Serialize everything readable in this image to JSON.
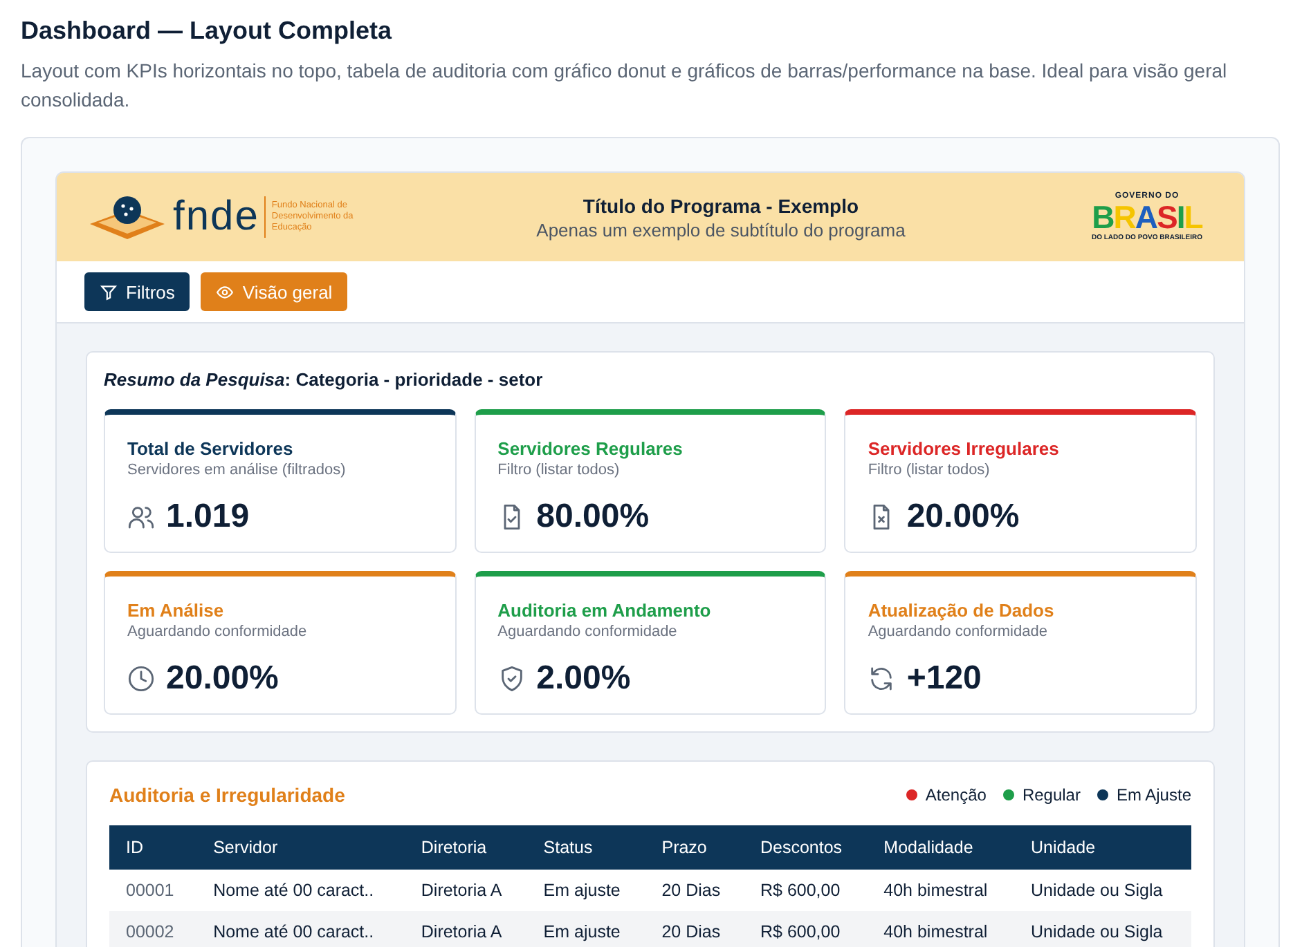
{
  "page": {
    "title": "Dashboard — Layout Completa",
    "description": "Layout com KPIs horizontais no topo, tabela de auditoria com gráfico donut e gráficos de barras/performance na base. Ideal para visão geral consolidada."
  },
  "header": {
    "logo_text": "fnde",
    "logo_caption": "Fundo Nacional de Desenvolvimento da Educação",
    "title": "Título do Programa - Exemplo",
    "subtitle": "Apenas um exemplo de subtítulo do programa",
    "gov_top": "GOVERNO DO",
    "gov_word": "BRASIL",
    "gov_bottom": "DO LADO DO POVO BRASILEIRO"
  },
  "toolbar": [
    {
      "label": "Filtros",
      "kind": "filter"
    },
    {
      "label": "Visão geral",
      "kind": "view"
    }
  ],
  "summary": {
    "text": "*Resumo da Pesquisa*: Categoria - prioridade - setor"
  },
  "kpis": [
    {
      "title": "Total de Servidores",
      "subtitle": "Servidores em análise (filtrados)",
      "value": "1.019",
      "kind": "users",
      "color": "#0d3658"
    },
    {
      "title": "Servidores Regulares",
      "subtitle": "Filtro (listar todos)",
      "value": "80.00%",
      "kind": "file-check",
      "color": "#1e9e4a"
    },
    {
      "title": "Servidores Irregulares",
      "subtitle": "Filtro (listar todos)",
      "value": "20.00%",
      "kind": "file-x",
      "color": "#dc2626"
    },
    {
      "title": "Em Análise",
      "subtitle": "Aguardando conformidade",
      "value": "20.00%",
      "kind": "clock",
      "color": "#e0801a"
    },
    {
      "title": "Auditoria em Andamento",
      "subtitle": "Aguardando conformidade",
      "value": "2.00%",
      "kind": "shield",
      "color": "#1e9e4a"
    },
    {
      "title": "Atualização de Dados",
      "subtitle": "Aguardando conformidade",
      "value": "+120",
      "kind": "refresh",
      "color": "#e0801a"
    }
  ],
  "audit": {
    "title": "Auditoria e Irregularidade",
    "legend": [
      {
        "label": "Atenção",
        "color": "#dc2626"
      },
      {
        "label": "Regular",
        "color": "#1e9e4a"
      },
      {
        "label": "Em Ajuste",
        "color": "#0d3658"
      }
    ],
    "columns": [
      "ID",
      "Servidor",
      "Diretoria",
      "Status",
      "Prazo",
      "Descontos",
      "Modalidade",
      "Unidade"
    ],
    "rows": [
      [
        "00001",
        "Nome até 00 caract..",
        "Diretoria A",
        "Em ajuste",
        "20 Dias",
        "R$ 600,00",
        "40h bimestral",
        "Unidade ou Sigla"
      ],
      [
        "00002",
        "Nome até 00 caract..",
        "Diretoria A",
        "Em ajuste",
        "20 Dias",
        "R$ 600,00",
        "40h bimestral",
        "Unidade ou Sigla"
      ]
    ]
  }
}
